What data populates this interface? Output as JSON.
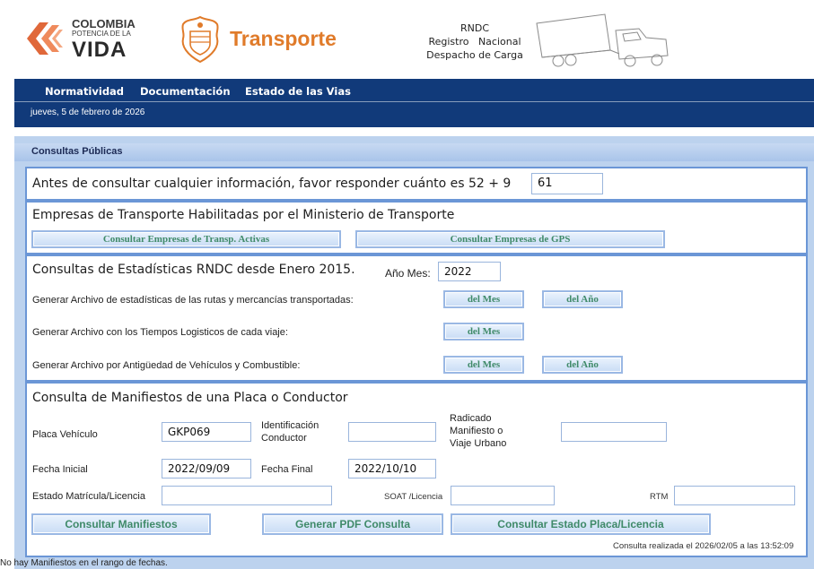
{
  "header": {
    "logo_line1": "COLOMBIA",
    "logo_line2": "POTENCIA DE LA",
    "logo_line3": "VIDA",
    "ministry": "Transporte",
    "rndc_title": "RNDC",
    "rndc_line2": "Registro   Nacional",
    "rndc_line3": "Despacho de Carga",
    "icons": [
      "colombia-logo-icon",
      "coat-of-arms-icon",
      "truck-icon"
    ],
    "colors": {
      "accent_orange": "#e07b2a",
      "nav_blue": "#113a7a"
    }
  },
  "nav": {
    "items": [
      "Normatividad",
      "Documentación",
      "Estado de las Vias"
    ],
    "date": "jueves, 5 de febrero de 2026"
  },
  "panel": {
    "title": "Consultas Públicas",
    "captcha": {
      "question": "Antes de consultar cualquier información, favor responder cuánto es 52 + 9",
      "answer": "61"
    },
    "empresas": {
      "title": "Empresas de Transporte Habilitadas por el Ministerio de Transporte",
      "btn_activas": "Consultar Empresas de Transp. Activas",
      "btn_gps": "Consultar Empresas de GPS"
    },
    "estadisticas": {
      "title": "Consultas de Estadísticas RNDC desde Enero 2015.",
      "ano_mes_label": "Año Mes:",
      "ano_mes_value": "2022",
      "row1": "Generar Archivo de estadísticas de las rutas y mercancías transportadas:",
      "row2": "Generar Archivo con los Tiempos Logisticos de cada viaje:",
      "row3": "Generar Archivo por Antigüedad de Vehículos y Combustible:",
      "btn_mes": "del Mes",
      "btn_ano": "del Año"
    },
    "manifiestos": {
      "title": "Consulta de Manifiestos de una Placa o Conductor",
      "placa_label": "Placa Vehículo",
      "placa_value": "GKP069",
      "ident_label": "Identificación Conductor",
      "ident_value": "",
      "radicado_label": "Radicado Manifiesto o Viaje Urbano",
      "radicado_value": "",
      "fecha_ini_label": "Fecha Inicial",
      "fecha_ini_value": "2022/09/09",
      "fecha_fin_label": "Fecha Final",
      "fecha_fin_value": "2022/10/10",
      "estado_label": "Estado Matrícula/Licencia",
      "estado_value": "",
      "soat_label": "SOAT /Licencia",
      "soat_value": "",
      "rtm_label": "RTM",
      "rtm_value": "",
      "btn_consultar": "Consultar Manifiestos",
      "btn_pdf": "Generar PDF Consulta",
      "btn_estado": "Consultar Estado Placa/Licencia",
      "consulta_time": "Consulta realizada el 2026/02/05 a las 13:52:09"
    },
    "status": "No hay Manifiestos en el rango de fechas."
  }
}
